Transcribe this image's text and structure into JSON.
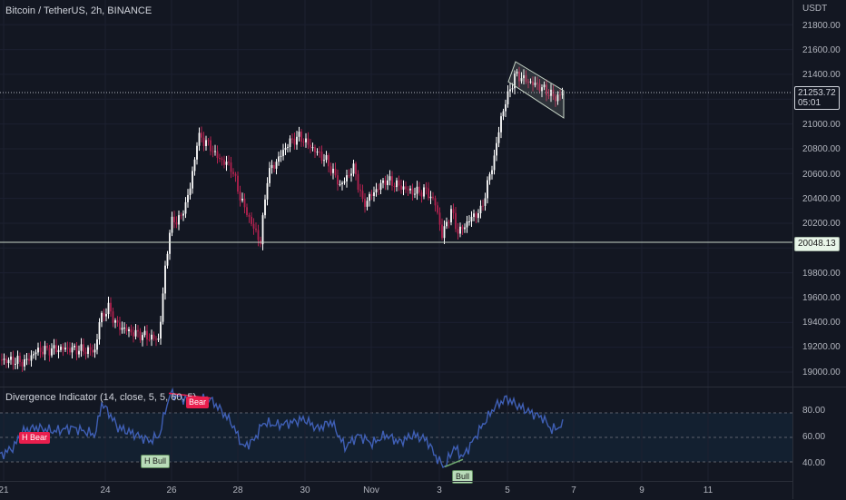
{
  "header": {
    "symbol_title": "Bitcoin / TetherUS, 2h, BINANCE"
  },
  "price_axis": {
    "currency": "USDT",
    "ticks": [
      "21800.00",
      "21600.00",
      "21400.00",
      "21000.00",
      "20800.00",
      "20600.00",
      "20400.00",
      "20200.00",
      "19800.00",
      "19600.00",
      "19400.00",
      "19200.00",
      "19000.00"
    ],
    "last_price": "21253.72",
    "countdown": "05:01",
    "level_price": "20048.13",
    "osc_ticks": [
      "80.00",
      "60.00",
      "40.00"
    ]
  },
  "time_axis": {
    "labels": [
      "21",
      "24",
      "26",
      "28",
      "30",
      "Nov",
      "3",
      "5",
      "7",
      "9",
      "11"
    ]
  },
  "indicator": {
    "title": "Divergence Indicator (14, close, 5, 5, 60, 5)",
    "signals": {
      "h_bear": "H Bear",
      "bear": "Bear",
      "h_bull": "H Bull",
      "bull": "Bull"
    }
  },
  "colors": {
    "background": "#131722",
    "up_candle": "#ffffff",
    "down_candle": "#b2224f",
    "osc_line": "#3f5fb5",
    "bear_signal": "#e91e4d",
    "bull_signal": "#b9dcb9"
  }
}
